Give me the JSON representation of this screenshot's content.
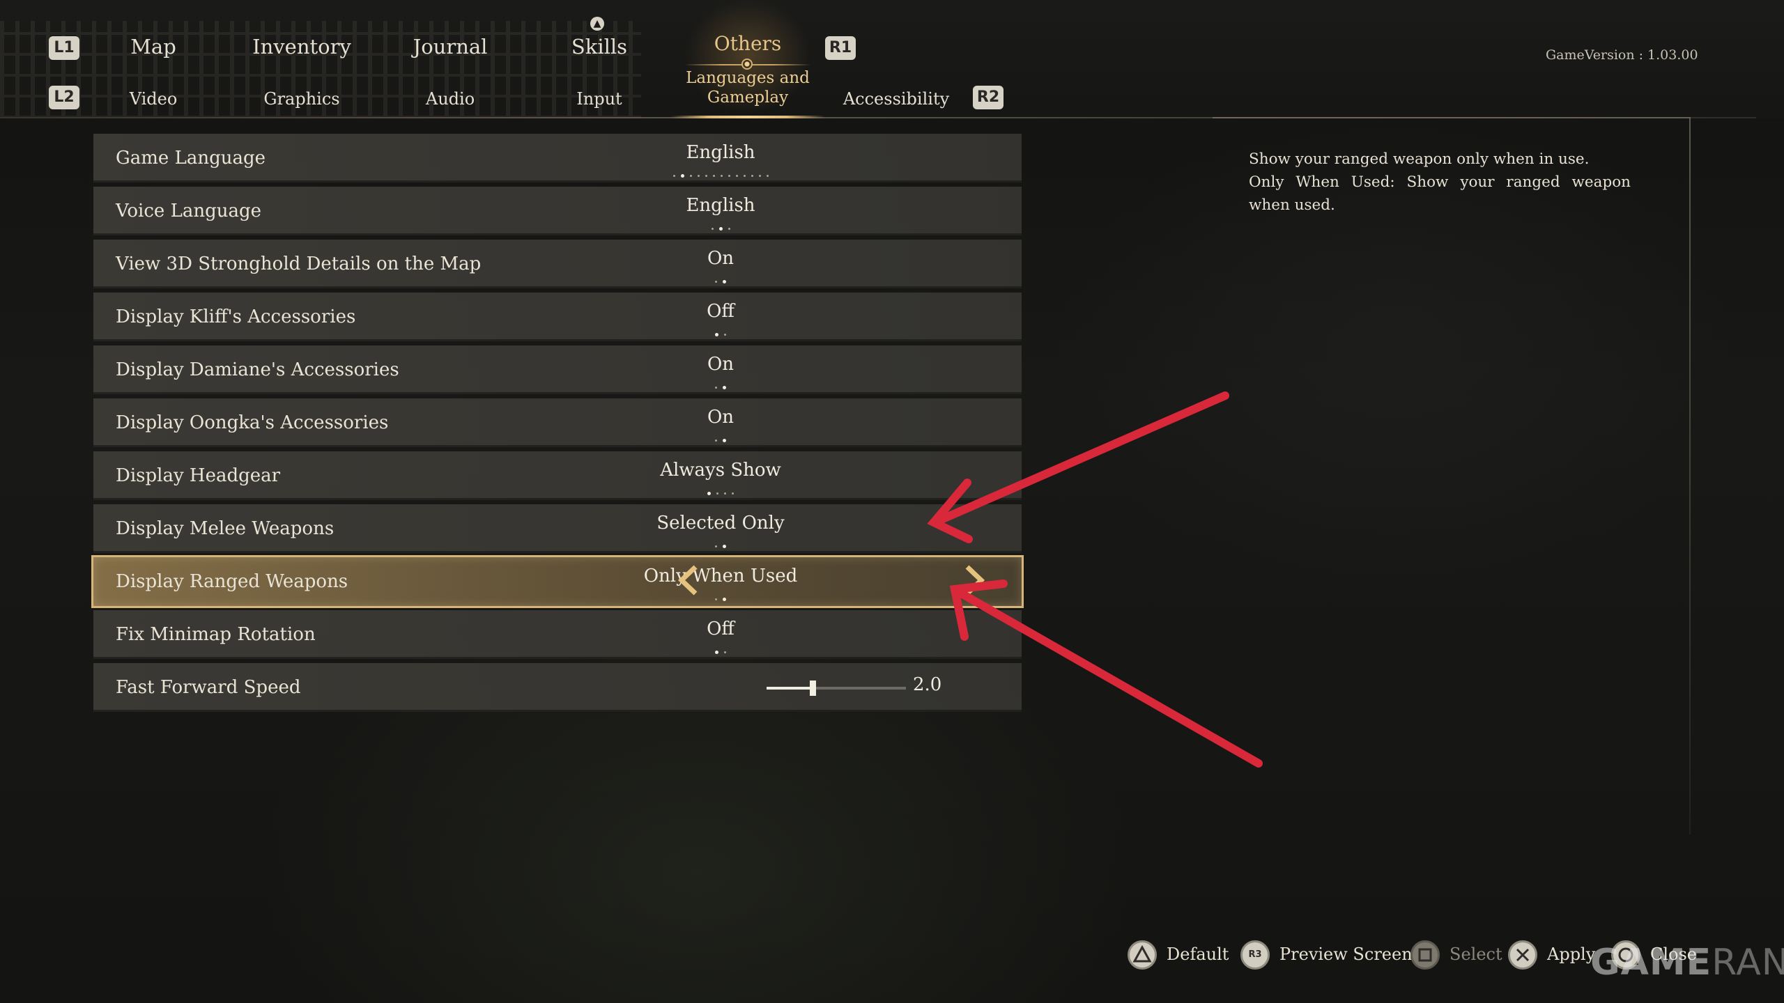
{
  "top_nav": {
    "l1": "L1",
    "r1": "R1",
    "l2": "L2",
    "r2": "R2",
    "tabs": [
      "Map",
      "Inventory",
      "Journal",
      "Skills",
      "Others"
    ],
    "active_tab": "Others"
  },
  "sub_nav": {
    "items": [
      "Video",
      "Graphics",
      "Audio",
      "Input",
      "Languages and Gameplay",
      "Accessibility"
    ],
    "active_line1": "Languages and",
    "active_line2": "Gameplay"
  },
  "version": "GameVersion : 1.03.00",
  "settings": [
    {
      "label": "Game Language",
      "value": "English",
      "options": 13,
      "index": 1
    },
    {
      "label": "Voice Language",
      "value": "English",
      "options": 3,
      "index": 1
    },
    {
      "label": "View 3D Stronghold Details on the Map",
      "value": "On",
      "options": 2,
      "index": 1
    },
    {
      "label": "Display Kliff's Accessories",
      "value": "Off",
      "options": 2,
      "index": 0
    },
    {
      "label": "Display Damiane's Accessories",
      "value": "On",
      "options": 2,
      "index": 1
    },
    {
      "label": "Display Oongka's Accessories",
      "value": "On",
      "options": 2,
      "index": 1
    },
    {
      "label": "Display Headgear",
      "value": "Always Show",
      "options": 4,
      "index": 0
    },
    {
      "label": "Display Melee Weapons",
      "value": "Selected Only",
      "options": 2,
      "index": 1
    },
    {
      "label": "Display Ranged Weapons",
      "value": "Only When Used",
      "options": 2,
      "index": 1,
      "selected": true
    },
    {
      "label": "Fix Minimap Rotation",
      "value": "Off",
      "options": 2,
      "index": 0
    },
    {
      "label": "Fast Forward Speed",
      "value": "2.0",
      "type": "slider",
      "fraction": 0.33
    }
  ],
  "description": {
    "line1": "Show your ranged weapon only when in use.",
    "line2": "Only When Used: Show your ranged weapon when used."
  },
  "footer": {
    "default": "Default",
    "preview": "Preview Screen",
    "select": "Select",
    "apply": "Apply",
    "close": "Close",
    "r3": "R3"
  },
  "watermark": {
    "part1": "GAME",
    "part2": "RANT"
  },
  "colors": {
    "accent_gold": "#d6b576",
    "annotation_red": "#d8283a"
  }
}
